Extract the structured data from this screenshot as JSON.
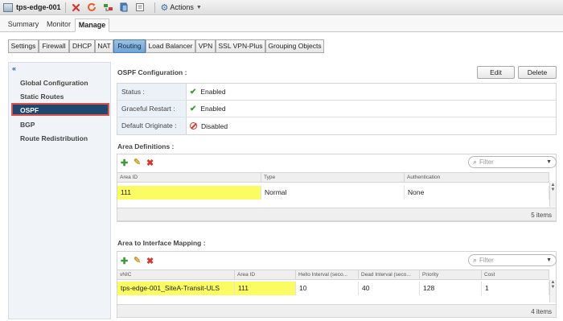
{
  "window": {
    "object_title": "tps-edge-001",
    "toolbar_icons": [
      "delete-icon",
      "refresh-icon",
      "deploy-icon",
      "snapshot-icon",
      "details-icon"
    ],
    "actions_label": "Actions"
  },
  "top_tabs": [
    {
      "label": "Summary"
    },
    {
      "label": "Monitor"
    },
    {
      "label": "Manage",
      "active": true
    }
  ],
  "sub_tabs": [
    {
      "label": "Settings"
    },
    {
      "label": "Firewall"
    },
    {
      "label": "DHCP"
    },
    {
      "label": "NAT"
    },
    {
      "label": "Routing",
      "active": true
    },
    {
      "label": "Load Balancer"
    },
    {
      "label": "VPN"
    },
    {
      "label": "SSL VPN-Plus"
    },
    {
      "label": "Grouping Objects"
    }
  ],
  "left_nav": {
    "collapse_glyph": "«",
    "items": [
      {
        "label": "Global Configuration"
      },
      {
        "label": "Static Routes"
      },
      {
        "label": "OSPF",
        "active": true
      },
      {
        "label": "BGP"
      },
      {
        "label": "Route Redistribution"
      }
    ]
  },
  "ospf": {
    "title": "OSPF Configuration :",
    "edit_label": "Edit",
    "delete_label": "Delete",
    "rows": [
      {
        "label": "Status :",
        "value": "Enabled",
        "state": "enabled"
      },
      {
        "label": "Graceful Restart :",
        "value": "Enabled",
        "state": "enabled"
      },
      {
        "label": "Default Originate :",
        "value": "Disabled",
        "state": "disabled"
      }
    ]
  },
  "area_definitions": {
    "title": "Area Definitions :",
    "filter_placeholder": "Filter",
    "columns": [
      "Area ID",
      "Type",
      "Authentication"
    ],
    "rows": [
      [
        "111",
        "Normal",
        "None"
      ]
    ],
    "footer": "5 items"
  },
  "interface_mapping": {
    "title": "Area to Interface Mapping :",
    "filter_placeholder": "Filter",
    "columns": [
      "vNIC",
      "Area ID",
      "Hello Interval (seco...",
      "Dead Interval (seco...",
      "Priority",
      "Cost"
    ],
    "rows": [
      [
        "tps-edge-001_SiteA-Transit-ULS",
        "111",
        "10",
        "40",
        "128",
        "1"
      ]
    ],
    "footer": "4 items"
  },
  "colors": {
    "highlight": "#fbfb62",
    "nav_active_bg": "#20476e",
    "nav_active_border": "#d9534f",
    "enabled_green": "#3d9b35",
    "disabled_red": "#d3372f"
  }
}
